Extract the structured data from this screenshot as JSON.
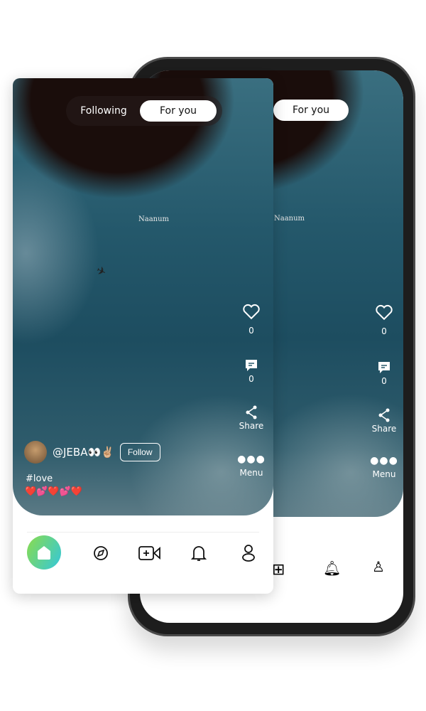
{
  "feed_tabs": {
    "following": "Following",
    "for_you": "For you",
    "active": "For you"
  },
  "video": {
    "watermark": "Naanum"
  },
  "actions": {
    "like_count": "0",
    "comment_count": "0",
    "share_label": "Share",
    "menu_label": "Menu"
  },
  "post": {
    "username": "@JEBA👀✌🏼",
    "follow_label": "Follow",
    "hashtag": "#love",
    "emojis": "❤️💕❤️💕❤️"
  },
  "nav": {
    "items": [
      "home-icon",
      "compass-icon",
      "add-video-icon",
      "bell-icon",
      "profile-icon"
    ]
  },
  "colors": {
    "home_gradient_start": "#8bdc4c",
    "home_gradient_end": "#33c7dc"
  }
}
